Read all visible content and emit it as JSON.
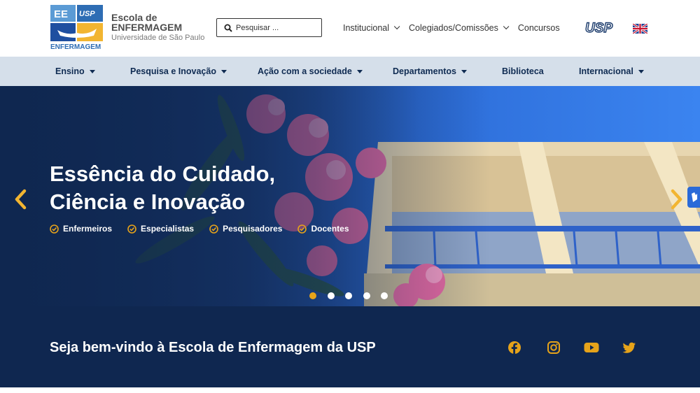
{
  "logo": {
    "badge_left": "EE",
    "badge_right": "USP",
    "badge_bottom": "ENFERMAGEM",
    "line1": "Escola de",
    "line2": "ENFERMAGEM",
    "line3": "Universidade de São Paulo"
  },
  "search": {
    "placeholder": "Pesquisar ..."
  },
  "top_nav": [
    {
      "label": "Institucional",
      "has_dropdown": true
    },
    {
      "label": "Colegiados/Comissões",
      "has_dropdown": true
    },
    {
      "label": "Concursos",
      "has_dropdown": false
    }
  ],
  "usp_logo": "USP",
  "language_flag": "uk-flag-icon",
  "main_nav": [
    {
      "label": "Ensino"
    },
    {
      "label": "Pesquisa e Inovação"
    },
    {
      "label": "Ação com a sociedade"
    },
    {
      "label": "Departamentos"
    },
    {
      "label": "Biblioteca"
    },
    {
      "label": "Internacional"
    }
  ],
  "hero": {
    "title_line1": "Essência do Cuidado,",
    "title_line2": "Ciência e Inovação",
    "tags": [
      "Enfermeiros",
      "Especialistas",
      "Pesquisadores",
      "Docentes"
    ],
    "active_slide": 1,
    "slide_count": 5
  },
  "welcome": "Seja bem-vindo à Escola de Enfermagem da USP",
  "social": [
    "facebook-icon",
    "instagram-icon",
    "youtube-icon",
    "twitter-icon"
  ],
  "colors": {
    "navy": "#0f2750",
    "accent": "#e6a31a",
    "nav_bg": "#d5dfea"
  }
}
